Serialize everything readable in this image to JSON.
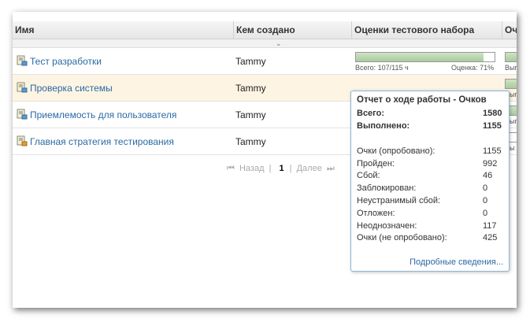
{
  "columns": {
    "name": "Имя",
    "created_by": "Кем создано",
    "test_set_scores": "Оценки тестового набора",
    "next": "Оче"
  },
  "rows": [
    {
      "name": "Тест разработки",
      "creator": "Tammy",
      "progress": 0.92,
      "total_label": "Всего: 107/115 ч",
      "score_label": "Оценка: 71%",
      "next_label": "Вып",
      "highlighted": false
    },
    {
      "name": "Проверка системы",
      "creator": "Tammy",
      "next_label": "Вып",
      "highlighted": true
    },
    {
      "name": "Приемлемость для пользователя",
      "creator": "Tammy",
      "next_label": "Вып",
      "highlighted": false
    },
    {
      "name": "Главная стратегия тестирования",
      "creator": "Tammy",
      "next_label": "Вы",
      "highlighted": false
    }
  ],
  "pager": {
    "first_icon": "first-page-icon",
    "back": "Назад",
    "sep": "|",
    "page": "1",
    "next": "Далее",
    "next_icon": "next-page-icon",
    "current_page": 1
  },
  "popup": {
    "title": "Отчет о ходе работы - Очков",
    "summary": [
      {
        "label": "Всего:",
        "value": "1580"
      },
      {
        "label": "Выполнено:",
        "value": "1155"
      }
    ],
    "details": [
      {
        "label": "Очки (опробовано):",
        "value": "1155"
      },
      {
        "label": "Пройден:",
        "value": "992"
      },
      {
        "label": "Сбой:",
        "value": "46"
      },
      {
        "label": "Заблокирован:",
        "value": "0"
      },
      {
        "label": "Неустранимый сбой:",
        "value": "0"
      },
      {
        "label": "Отложен:",
        "value": "0"
      },
      {
        "label": "Неоднозначен:",
        "value": "117"
      },
      {
        "label": "Очки (не опробовано):",
        "value": "425"
      }
    ],
    "link": "Подробные сведения..."
  },
  "colors": {
    "link": "#2a6aa3",
    "highlight_row": "#fef4e3",
    "progress_fill": "#a8cb9c",
    "popup_border": "#8fb6d2"
  }
}
